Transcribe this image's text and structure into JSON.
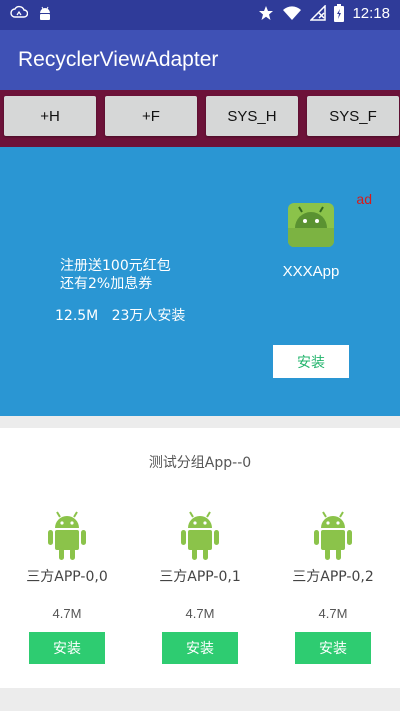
{
  "status_bar": {
    "time": "12:18",
    "left_icons": [
      "cloud-sync-icon",
      "android-debug-icon"
    ],
    "right_icons": [
      "star-icon",
      "wifi-icon",
      "no-signal-icon",
      "battery-charging-icon"
    ]
  },
  "app_bar": {
    "title": "RecyclerViewAdapter"
  },
  "toolbar": {
    "buttons": [
      "+H",
      "+F",
      "SYS_H",
      "SYS_F"
    ]
  },
  "ad_banner": {
    "promo_line1": "注册送100元红包",
    "promo_line2": "还有2%加息券",
    "stats": "12.5M   23万人安装",
    "badge": "ad",
    "app_name": "XXXApp",
    "install_label": "安装"
  },
  "group": {
    "title": "测试分组App--0",
    "apps": [
      {
        "name": "三方APP-0,0",
        "size": "4.7M",
        "install_label": "安装"
      },
      {
        "name": "三方APP-0,1",
        "size": "4.7M",
        "install_label": "安装"
      },
      {
        "name": "三方APP-0,2",
        "size": "4.7M",
        "install_label": "安装"
      }
    ]
  },
  "colors": {
    "status_bar": "#2f3b99",
    "app_bar": "#3f51b5",
    "button_strip": "#6d1239",
    "ad_banner": "#2a96d3",
    "android_green": "#8bc34a",
    "install_green": "#2ecc71",
    "ad_badge_red": "#d71b1b"
  }
}
